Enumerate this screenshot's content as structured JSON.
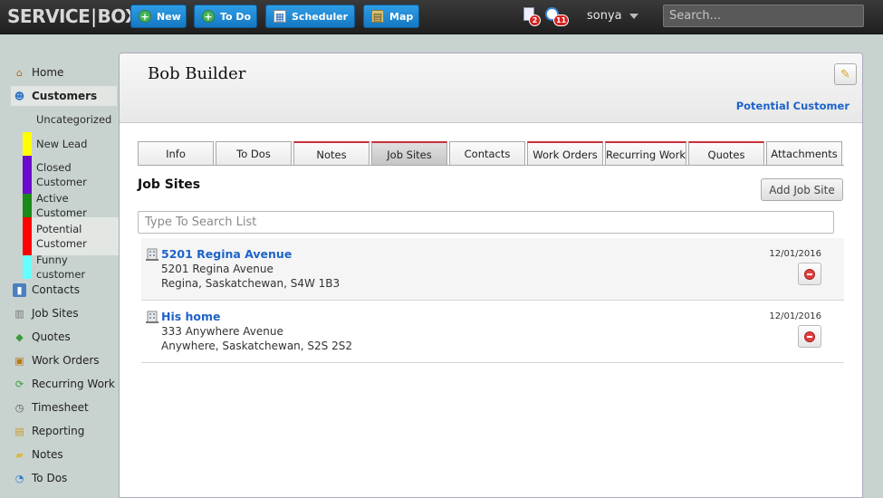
{
  "brand": {
    "left": "SERVICE",
    "separator": "|",
    "right": "BOX"
  },
  "topbar": {
    "buttons": [
      {
        "label": "New",
        "icon": "plus-circle-icon"
      },
      {
        "label": "To Do",
        "icon": "plus-circle-icon"
      },
      {
        "label": "Scheduler",
        "icon": "calendar-icon"
      },
      {
        "label": "Map",
        "icon": "map-icon"
      }
    ],
    "notifications": [
      {
        "icon": "document-alert-icon",
        "count": "2"
      },
      {
        "icon": "alarm-clock-icon",
        "count": "11"
      }
    ],
    "username": "sonya",
    "search_placeholder": "Search..."
  },
  "sidebar": {
    "items": [
      {
        "label": "Home",
        "icon": "home-icon"
      },
      {
        "label": "Customers",
        "icon": "customers-icon",
        "active": true
      },
      {
        "label": "Contacts",
        "icon": "contacts-book-icon"
      },
      {
        "label": "Job Sites",
        "icon": "building-icon"
      },
      {
        "label": "Quotes",
        "icon": "quote-tag-icon"
      },
      {
        "label": "Work Orders",
        "icon": "work-orders-icon"
      },
      {
        "label": "Recurring Work",
        "icon": "recurring-arrows-icon"
      },
      {
        "label": "Timesheet",
        "icon": "clock-icon"
      },
      {
        "label": "Reporting",
        "icon": "reporting-icon"
      },
      {
        "label": "Notes",
        "icon": "notes-icon"
      },
      {
        "label": "To Dos",
        "icon": "todo-clock-icon"
      }
    ],
    "customer_categories": [
      {
        "label": "Uncategorized",
        "color": ""
      },
      {
        "label": "New Lead",
        "color": "#ffff00"
      },
      {
        "label": "Closed Customer",
        "color": "#6a0dcc"
      },
      {
        "label": "Active Customer",
        "color": "#1a8a1a"
      },
      {
        "label": "Potential Customer",
        "color": "#ff0000",
        "selected": true
      },
      {
        "label": "Funny customer",
        "color": "#66ffff"
      }
    ]
  },
  "customer": {
    "name": "Bob Builder",
    "status": "Potential Customer"
  },
  "tabs": [
    {
      "label": "Info"
    },
    {
      "label": "To Dos"
    },
    {
      "label": "Notes"
    },
    {
      "label": "Job Sites",
      "active": true
    },
    {
      "label": "Contacts"
    },
    {
      "label": "Work Orders"
    },
    {
      "label": "Recurring Work"
    },
    {
      "label": "Quotes"
    },
    {
      "label": "Attachments"
    }
  ],
  "jobsites": {
    "title": "Job Sites",
    "add_label": "Add Job Site",
    "search_placeholder": "Type To Search List",
    "items": [
      {
        "name": "5201 Regina Avenue",
        "address1": "5201 Regina Avenue",
        "address2": "Regina, Saskatchewan, S4W 1B3",
        "date": "12/01/2016"
      },
      {
        "name": "His home",
        "address1": "333 Anywhere Avenue",
        "address2": "Anywhere, Saskatchewan, S2S 2S2",
        "date": "12/01/2016"
      }
    ]
  },
  "colors": {
    "accent": "#1e63c9",
    "button_blue": "#1f86d4",
    "tab_marker": "#c8303a"
  }
}
